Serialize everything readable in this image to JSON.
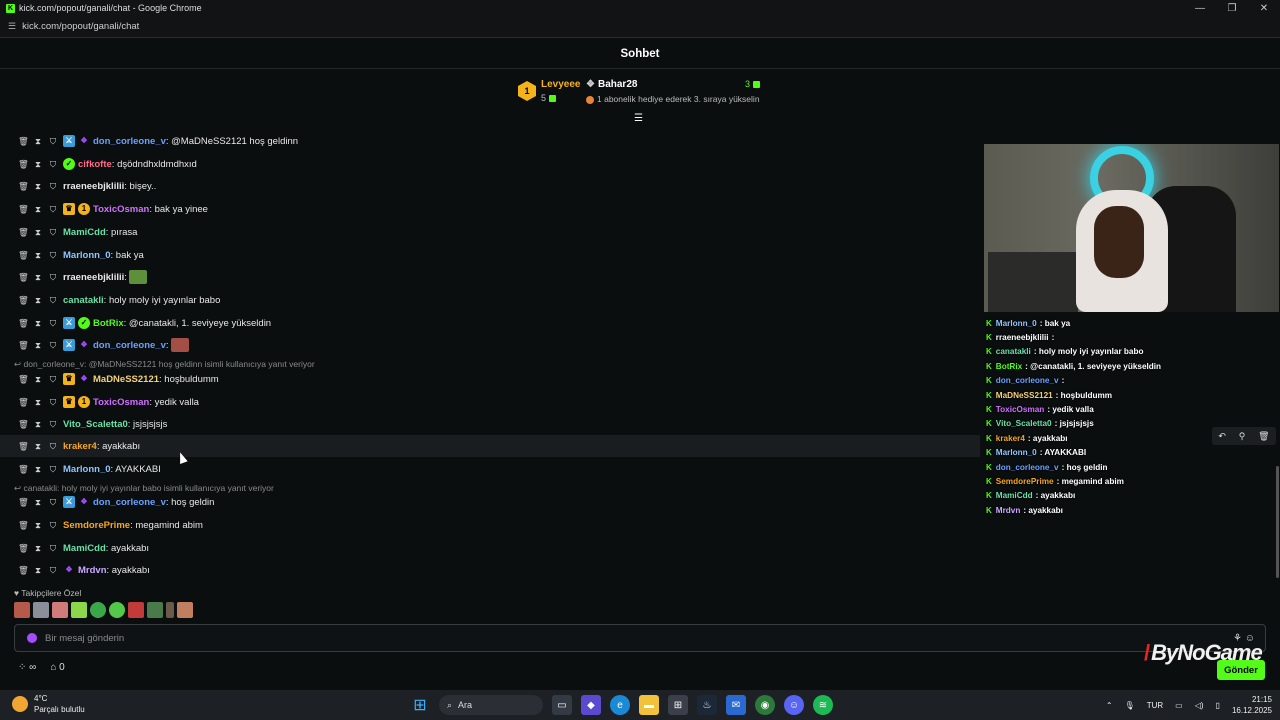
{
  "window": {
    "title": "kick.com/popout/ganali/chat - Google Chrome",
    "url": "kick.com/popout/ganali/chat"
  },
  "header": {
    "title": "Sohbet"
  },
  "leaderboard": {
    "rank": "1",
    "first": {
      "name": "Levyeee",
      "count": "5"
    },
    "second": {
      "name": "Bahar28",
      "count": "3",
      "desc": "1 abonelik hediye ederek 3. sıraya yükselin"
    }
  },
  "messages": [
    {
      "user": "don_corleone_v",
      "color": "#6aa0ff",
      "text": ": @MaDNeSS2121 hoş geldinn",
      "badges": [
        "mod",
        "gift"
      ]
    },
    {
      "user": "cifkofte",
      "color": "#ff6b8a",
      "text": ": dşödndhxldmdhxıd",
      "badges": [
        "og"
      ]
    },
    {
      "user": "rraeneebjklilii",
      "color": "#e8e8e8",
      "text": ": bişey..",
      "badges": []
    },
    {
      "user": "ToxicOsman",
      "color": "#d070ff",
      "text": ": bak ya yinee",
      "badges": [
        "vip",
        "sub"
      ]
    },
    {
      "user": "MamiCdd",
      "color": "#6be0a8",
      "text": ": pırasa",
      "badges": []
    },
    {
      "user": "Marlonn_0",
      "color": "#8fc5ff",
      "text": ": bak ya",
      "badges": []
    },
    {
      "user": "rraeneebjklilii",
      "color": "#e8e8e8",
      "text": ": ",
      "badges": [],
      "emote": "#5f8f3b"
    },
    {
      "user": "canatakli",
      "color": "#6be0a8",
      "text": ": holy moly iyi yayınlar babo",
      "badges": []
    },
    {
      "user": "BotRix",
      "color": "#53fc18",
      "text": ": @canatakli, 1. seviyeye yükseldin",
      "badges": [
        "mod",
        "og"
      ]
    },
    {
      "user": "don_corleone_v",
      "color": "#6aa0ff",
      "text": ": ",
      "badges": [
        "mod",
        "gift"
      ],
      "emote": "#a34f46"
    },
    {
      "user": "MaDNeSS2121",
      "color": "#f5d27a",
      "text": ": hoşbuldumm",
      "badges": [
        "vip",
        "gift"
      ]
    },
    {
      "user": "ToxicOsman",
      "color": "#d070ff",
      "text": ": yedik valla",
      "badges": [
        "vip",
        "sub"
      ]
    },
    {
      "user": "Vito_Scaletta0",
      "color": "#6be0a8",
      "text": ": jsjsjsjsjs",
      "badges": []
    },
    {
      "user": "kraker4",
      "color": "#f5a623",
      "text": ": ayakkabı",
      "badges": []
    },
    {
      "user": "Marlonn_0",
      "color": "#8fc5ff",
      "text": ": AYAKKABI",
      "badges": []
    },
    {
      "user": "don_corleone_v",
      "color": "#6aa0ff",
      "text": ": hoş geldin",
      "badges": [
        "mod",
        "gift"
      ]
    },
    {
      "user": "SemdorePrime",
      "color": "#f5a623",
      "text": ": megamind abim",
      "badges": []
    },
    {
      "user": "MamiCdd",
      "color": "#6be0a8",
      "text": ": ayakkabı",
      "badges": []
    },
    {
      "user": "Mrdvn",
      "color": "#c9a8ff",
      "text": ": ayakkabı",
      "badges": [
        "gift"
      ]
    }
  ],
  "replies": [
    {
      "text": "don_corleone_v: @MaDNeSS2121 hoş geldinn isimli kullanıcıya yanıt veriyor"
    },
    {
      "text": "canatakli: holy moly iyi yayınlar babo isimli kullanıcıya yanıt veriyor"
    }
  ],
  "followers_only": "Takipçilere Özel",
  "input": {
    "placeholder": "Bir mesaj gönderin"
  },
  "bottom": {
    "infinity": "∞",
    "count": "0"
  },
  "send_label": "Gönder",
  "watermark": "ByNoGame",
  "overlay": [
    {
      "user": "Marlonn_0",
      "color": "#8fc5ff",
      "text": " : bak ya"
    },
    {
      "user": "rraeneebjklilii",
      "color": "#fff",
      "text": " : "
    },
    {
      "user": "canatakli",
      "color": "#6be0a8",
      "text": " : holy moly iyi yayınlar babo"
    },
    {
      "user": "BotRix",
      "color": "#53fc18",
      "text": " : @canatakli, 1. seviyeye yükseldin"
    },
    {
      "user": "don_corleone_v",
      "color": "#6aa0ff",
      "text": " : "
    },
    {
      "user": "MaDNeSS2121",
      "color": "#f5d27a",
      "text": " : hoşbuldumm"
    },
    {
      "user": "ToxicOsman",
      "color": "#d070ff",
      "text": " : yedik valla"
    },
    {
      "user": "Vito_Scaletta0",
      "color": "#6be0a8",
      "text": " : jsjsjsjsjs"
    },
    {
      "user": "kraker4",
      "color": "#f5a623",
      "text": " : ayakkabı"
    },
    {
      "user": "Marlonn_0",
      "color": "#8fc5ff",
      "text": " : AYAKKABI"
    },
    {
      "user": "don_corleone_v",
      "color": "#6aa0ff",
      "text": " : hoş geldin"
    },
    {
      "user": "SemdorePrime",
      "color": "#f5a623",
      "text": " : megamind abim"
    },
    {
      "user": "MamiCdd",
      "color": "#6be0a8",
      "text": " : ayakkabı"
    },
    {
      "user": "Mrdvn",
      "color": "#c9a8ff",
      "text": " : ayakkabı"
    }
  ],
  "taskbar": {
    "temp": "4°C",
    "weather": "Parçalı bulutlu",
    "search": "Ara",
    "lang": "TUR",
    "time": "21:15",
    "date": "16.12.2025"
  }
}
